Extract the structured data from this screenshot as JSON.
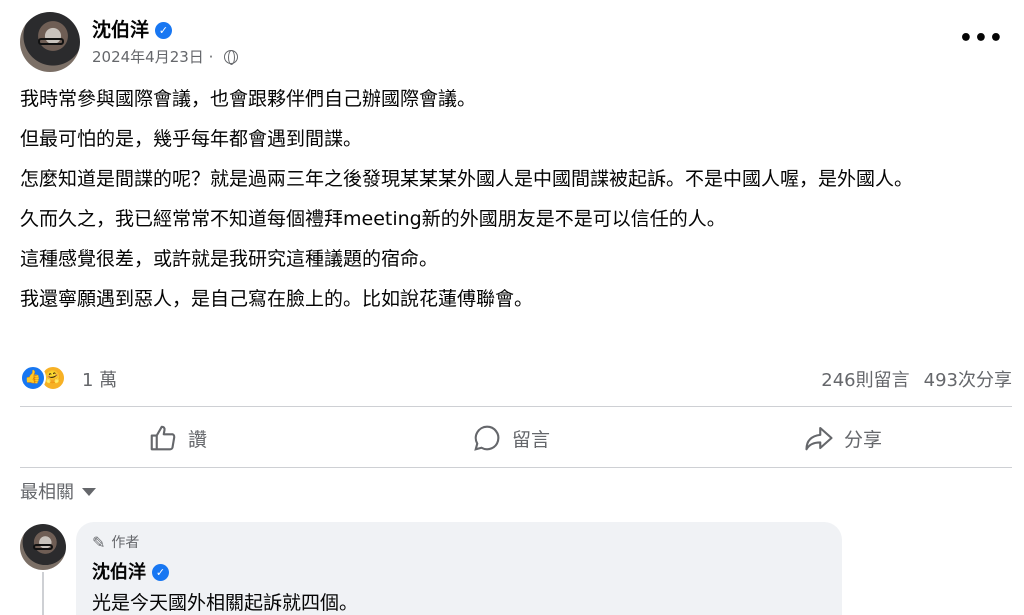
{
  "post": {
    "author": "沈伯洋",
    "date": "2024年4月23日",
    "separator": "·",
    "paragraphs": [
      "我時常參與國際會議，也會跟夥伴們自己辦國際會議。",
      "但最可怕的是，幾乎每年都會遇到間諜。",
      "怎麼知道是間諜的呢？就是過兩三年之後發現某某某外國人是中國間諜被起訴。不是中國人喔，是外國人。",
      "久而久之，我已經常常不知道每個禮拜meeting新的外國朋友是不是可以信任的人。",
      "這種感覺很差，或許就是我研究這種議題的宿命。",
      "我還寧願遇到惡人，是自己寫在臉上的。比如說花蓮傅聯會。"
    ],
    "more_icon": "•••",
    "verified_icon": "✓"
  },
  "reactions": {
    "count": "1 萬",
    "comments": "246則留言",
    "shares": "493次分享",
    "like_icon": "👍",
    "care_icon": "🤗"
  },
  "actions": {
    "like": "讚",
    "comment": "留言",
    "share": "分享"
  },
  "filter": {
    "label": "最相關"
  },
  "comment": {
    "badge": "作者",
    "author": "沈伯洋",
    "text": "光是今天國外相關起訴就四個。",
    "pencil_icon": "✎"
  },
  "colors": {
    "accent": "#1877f2",
    "secondary_text": "#65676b",
    "bubble": "#f0f2f5"
  }
}
